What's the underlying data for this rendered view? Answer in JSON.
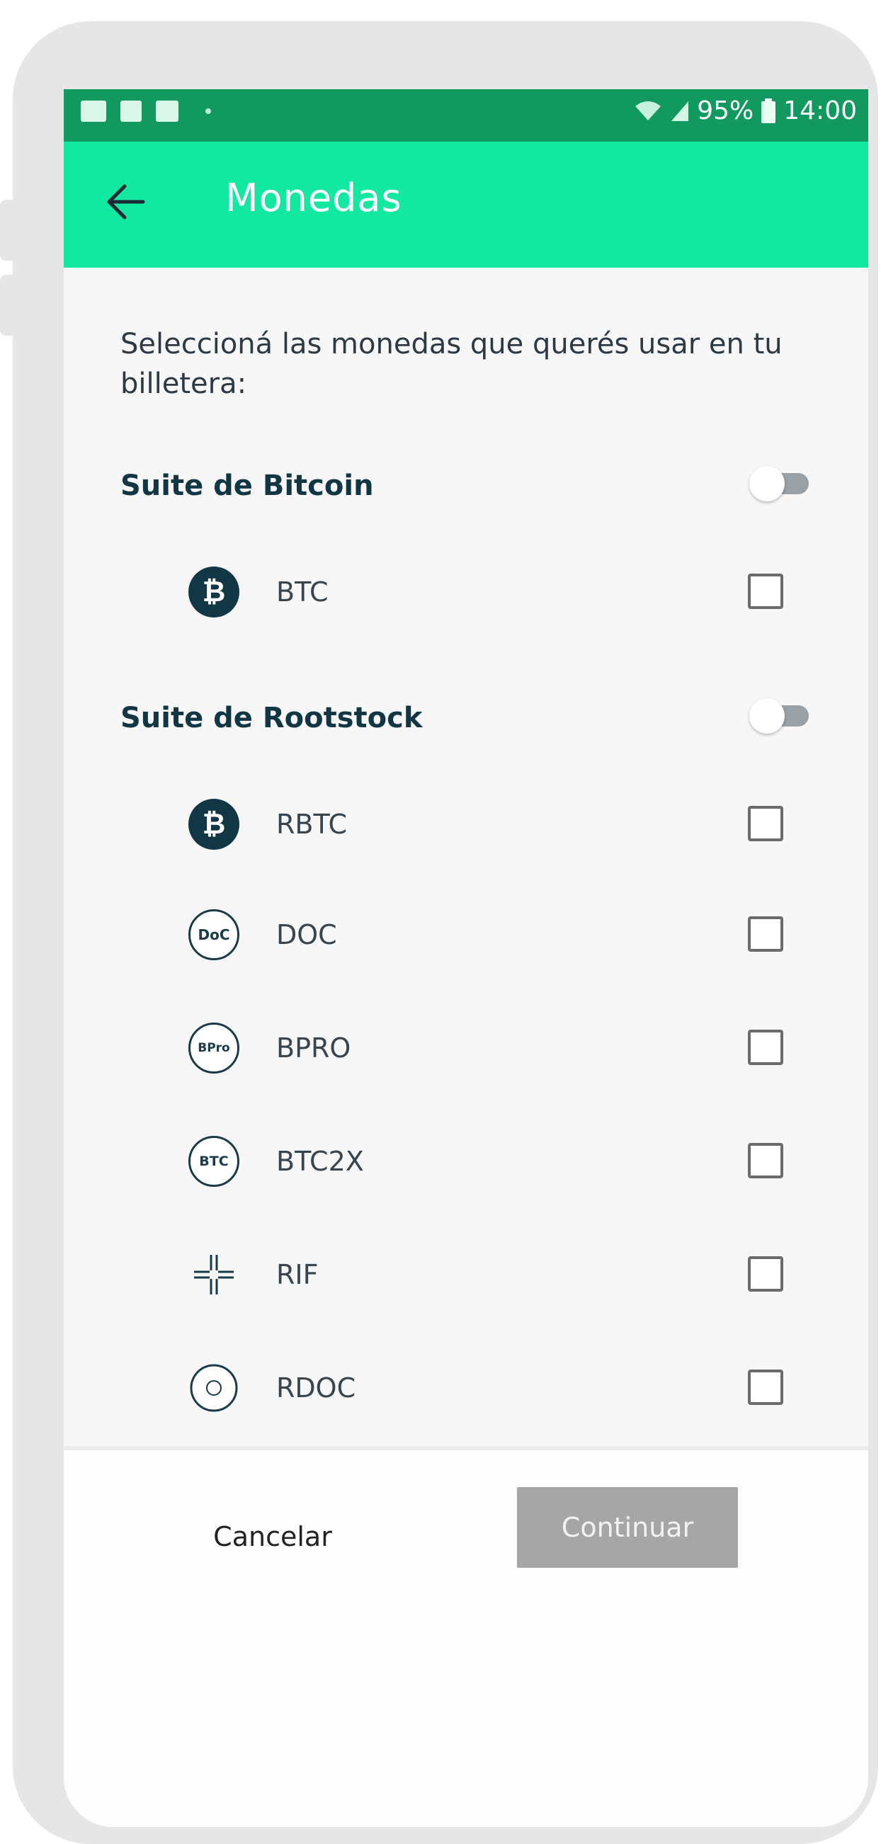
{
  "statusbar": {
    "battery": "95%",
    "time": "14:00",
    "icons": [
      "gallery-icon",
      "facebook-icon",
      "folder-icon",
      "wifi-icon",
      "signal-icon",
      "battery-icon"
    ]
  },
  "appbar": {
    "back_icon": "arrow-left-icon",
    "title": "Monedas"
  },
  "intro_text": "Seleccioná las monedas que querés usar en tu billetera:",
  "sections": [
    {
      "label": "Suite de Bitcoin",
      "toggle_on": false,
      "coins": [
        {
          "label": "BTC",
          "icon": "bitcoin-icon",
          "checked": false
        }
      ]
    },
    {
      "label": "Suite de Rootstock",
      "toggle_on": false,
      "coins": [
        {
          "label": "RBTC",
          "icon": "rbtc-icon",
          "checked": false
        },
        {
          "label": "DOC",
          "icon": "doc-icon",
          "checked": false,
          "badge": "DoC"
        },
        {
          "label": "BPRO",
          "icon": "bpro-icon",
          "checked": false,
          "badge": "BPro"
        },
        {
          "label": "BTC2X",
          "icon": "btc2x-icon",
          "checked": false,
          "badge": "BTC"
        },
        {
          "label": "RIF",
          "icon": "rif-icon",
          "checked": false
        },
        {
          "label": "RDOC",
          "icon": "rdoc-icon",
          "checked": false
        }
      ]
    }
  ],
  "footer": {
    "cancel_label": "Cancelar",
    "continue_label": "Continuar"
  },
  "colors": {
    "statusbar": "#129960",
    "appbar": "#12e8a0",
    "section_text": "#123644",
    "continue_disabled": "#a6a6a6"
  }
}
